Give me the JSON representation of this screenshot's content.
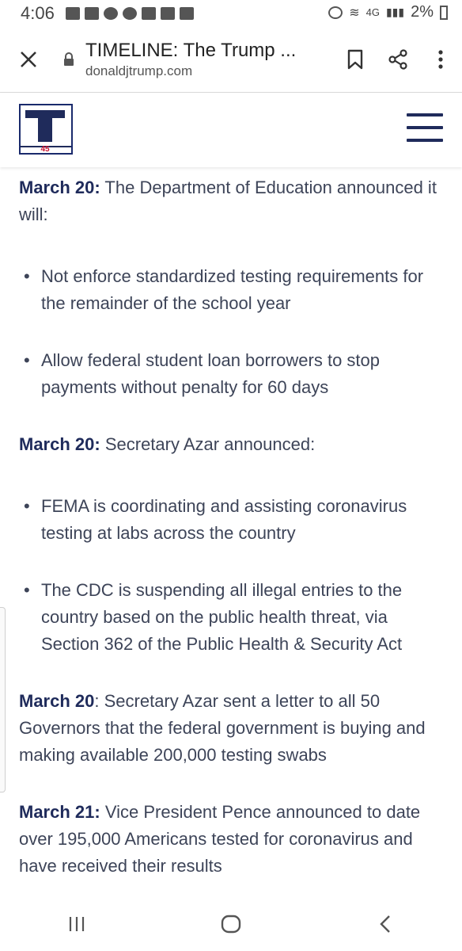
{
  "status": {
    "time": "4:06",
    "network": "4G",
    "battery": "2%"
  },
  "browser": {
    "title": "TIMELINE: The Trump ...",
    "domain": "donaldjtrump.com",
    "close_icon": "close-icon",
    "bookmark_icon": "bookmark-icon",
    "share_icon": "share-icon",
    "more_icon": "more-vertical-icon"
  },
  "site": {
    "logo_letter": "T",
    "logo_number": "45",
    "brand_color": "#1f2b5b",
    "accent_color": "#c8102e"
  },
  "entries": [
    {
      "date": "March 20:",
      "text": " The Department of Education announced it will:",
      "bullets": [
        "Not enforce standardized testing requirements for the remainder of the school year",
        "Allow federal student loan borrowers to stop payments without penalty for 60 days"
      ]
    },
    {
      "date": "March 20:",
      "text": " Secretary Azar announced:",
      "bullets": [
        "FEMA is coordinating and assisting coronavirus testing at labs across the country",
        "The CDC is suspending all illegal entries to the country based on the public health threat, via Section 362 of the Public Health & Security Act"
      ]
    },
    {
      "date": "March 20",
      "text": ": Secretary Azar sent a letter to all 50 Governors that the federal government is buying and making available 200,000 testing swabs",
      "bullets": []
    },
    {
      "date": "March 21:",
      "text": " Vice President Pence announced to date over 195,000 Americans tested for coronavirus and have received their results",
      "bullets": []
    }
  ],
  "nav": {
    "recents_icon": "recents-icon",
    "home_icon": "home-icon",
    "back_icon": "back-icon"
  }
}
